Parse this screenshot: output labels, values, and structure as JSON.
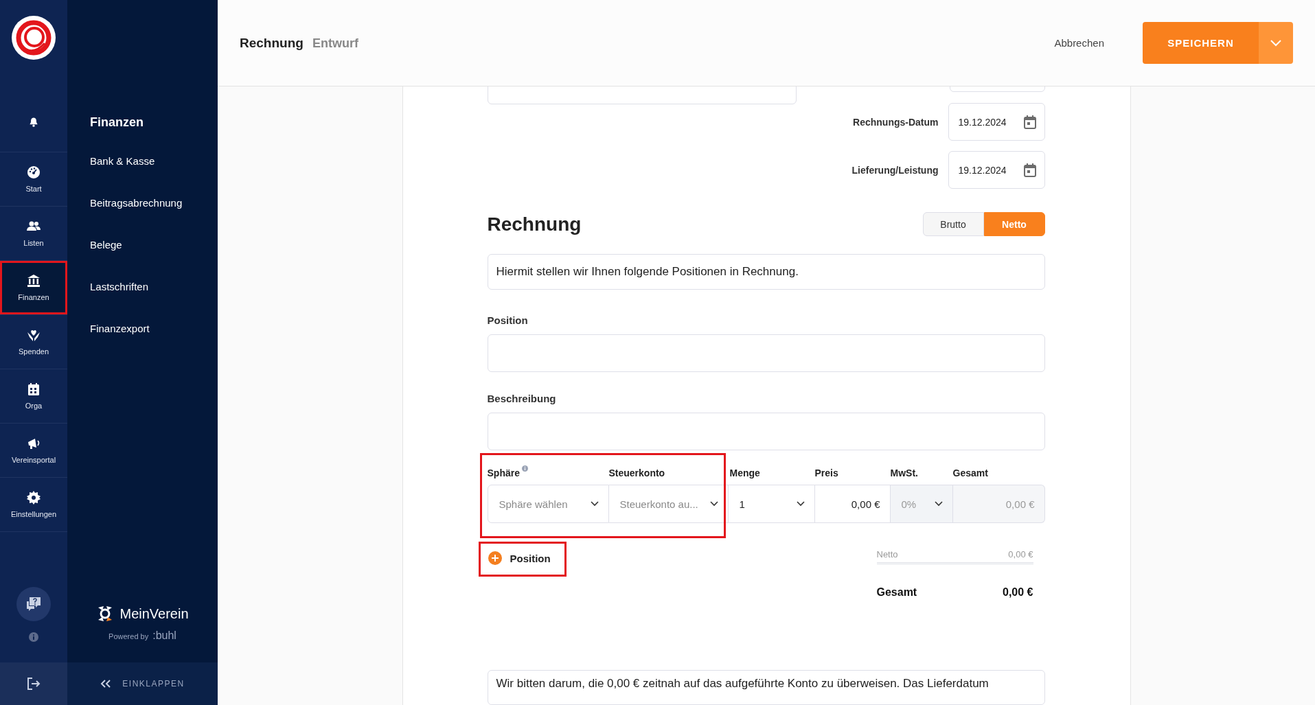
{
  "rail": {
    "items": [
      {
        "label": "Start",
        "selected": false,
        "highlighted": false
      },
      {
        "label": "Listen",
        "selected": false,
        "highlighted": false
      },
      {
        "label": "Finanzen",
        "selected": true,
        "highlighted": true
      },
      {
        "label": "Spenden",
        "selected": false,
        "highlighted": false
      },
      {
        "label": "Orga",
        "selected": false,
        "highlighted": false
      },
      {
        "label": "Vereinsportal",
        "selected": false,
        "highlighted": false
      },
      {
        "label": "Einstellungen",
        "selected": false,
        "highlighted": false
      }
    ]
  },
  "subnav": {
    "title": "Finanzen",
    "items": [
      {
        "label": "Bank & Kasse"
      },
      {
        "label": "Beitragsabrechnung"
      },
      {
        "label": "Belege"
      },
      {
        "label": "Lastschriften"
      },
      {
        "label": "Finanzexport"
      }
    ]
  },
  "brand": {
    "name": "MeinVerein",
    "powered_by": "Powered by",
    "powered_brand": ":buhl"
  },
  "collapse": "EINKLAPPEN",
  "header": {
    "title": "Rechnung",
    "status": "Entwurf",
    "cancel": "Abbrechen",
    "save": "SPEICHERN"
  },
  "dates": [
    {
      "label": "Rechnungs-Datum",
      "value": "19.12.2024"
    },
    {
      "label": "Lieferung/Leistung",
      "value": "19.12.2024"
    }
  ],
  "invoice": {
    "heading": "Rechnung",
    "modes": [
      {
        "label": "Brutto",
        "selected": false
      },
      {
        "label": "Netto",
        "selected": true
      }
    ],
    "intro": "Hiermit stellen wir Ihnen folgende Positionen in Rechnung.",
    "fields": [
      {
        "label": "Position"
      },
      {
        "label": "Beschreibung"
      }
    ]
  },
  "line": {
    "groups": [
      {
        "highlighted": true,
        "columns": [
          {
            "label": "Sphäre",
            "info": true,
            "kind": "select",
            "placeholder": "Sphäre wählen"
          },
          {
            "label": "Steuerkonto",
            "info": false,
            "kind": "select",
            "placeholder": "Steuerkonto au..."
          }
        ]
      },
      {
        "highlighted": false,
        "columns": [
          {
            "label": "Menge",
            "info": false,
            "kind": "select",
            "value": "1"
          },
          {
            "label": "Preis",
            "info": false,
            "kind": "input",
            "value": "0,00 €"
          },
          {
            "label": "MwSt.",
            "info": false,
            "kind": "select",
            "value": "0%",
            "disabled": true
          },
          {
            "label": "Gesamt",
            "info": false,
            "kind": "readonly",
            "value": "0,00 €"
          }
        ]
      }
    ]
  },
  "add_position": {
    "label": "Position",
    "highlighted": true
  },
  "totals": {
    "netto_label": "Netto",
    "netto": "0,00 €",
    "total_label": "Gesamt",
    "total": "0,00 €"
  },
  "closing": "Wir bitten darum, die 0,00 € zeitnah auf das aufgeführte Konto zu überweisen. Das Lieferdatum"
}
